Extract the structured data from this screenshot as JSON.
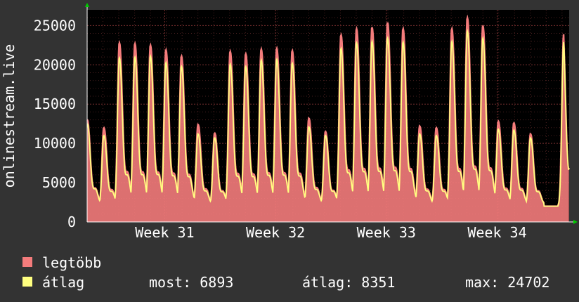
{
  "chart_data": {
    "type": "area",
    "ylabel": "onlinestream.live",
    "ylim": [
      0,
      27000
    ],
    "xlim": [
      0,
      4.35
    ],
    "yticks": [
      0,
      5000,
      10000,
      15000,
      20000,
      25000
    ],
    "ytick_labels": [
      "0",
      "5000",
      "10000",
      "15000",
      "20000",
      "25000"
    ],
    "xticks": [
      {
        "label": "Week 31",
        "x": 0.7
      },
      {
        "label": "Week 32",
        "x": 1.7
      },
      {
        "label": "Week 33",
        "x": 2.7
      },
      {
        "label": "Week 34",
        "x": 3.7
      }
    ],
    "grid": true,
    "legend_placement": "bottom-left",
    "series": [
      {
        "name": "legtöbb",
        "color": "#f47c7c",
        "daily_peaks": [
          13000,
          12000,
          22800,
          22700,
          22500,
          21900,
          21100,
          12400,
          11300,
          21700,
          21400,
          22000,
          22100,
          21800,
          13200,
          11500,
          23800,
          24600,
          24800,
          25400,
          24600,
          12200,
          12000,
          24600,
          26000,
          25000,
          12800,
          12600,
          11200,
          23900
        ],
        "peak_days": [
          0.0,
          0.15,
          0.29,
          0.43,
          0.57,
          0.71,
          0.85,
          1.0,
          1.15,
          1.29,
          1.43,
          1.57,
          1.71,
          1.85,
          2.0,
          2.15,
          2.29,
          2.43,
          2.57,
          2.71,
          2.85,
          3.0,
          3.15,
          3.29,
          3.43,
          3.57,
          3.71,
          3.85,
          4.0,
          4.3
        ]
      },
      {
        "name": "átlag",
        "color": "#ffff80",
        "daily_peaks": [
          12500,
          11000,
          20900,
          21000,
          21100,
          20300,
          19800,
          11200,
          10700,
          20100,
          19800,
          20600,
          20700,
          20200,
          12100,
          11000,
          22100,
          22800,
          23000,
          23400,
          22900,
          11200,
          11000,
          23000,
          24300,
          23400,
          11800,
          11700,
          10700,
          22900
        ],
        "peak_days": [
          0.0,
          0.15,
          0.29,
          0.43,
          0.57,
          0.71,
          0.85,
          1.0,
          1.15,
          1.29,
          1.43,
          1.57,
          1.71,
          1.85,
          2.0,
          2.15,
          2.29,
          2.43,
          2.57,
          2.71,
          2.85,
          3.0,
          3.15,
          3.29,
          3.43,
          3.57,
          3.71,
          3.85,
          4.0,
          4.3
        ]
      }
    ]
  },
  "legend": {
    "max_label": "legtöbb",
    "avg_label": "átlag",
    "stats": {
      "most": "most: 6893",
      "atlag": "átlag: 8351",
      "max": "max: 24702"
    }
  }
}
